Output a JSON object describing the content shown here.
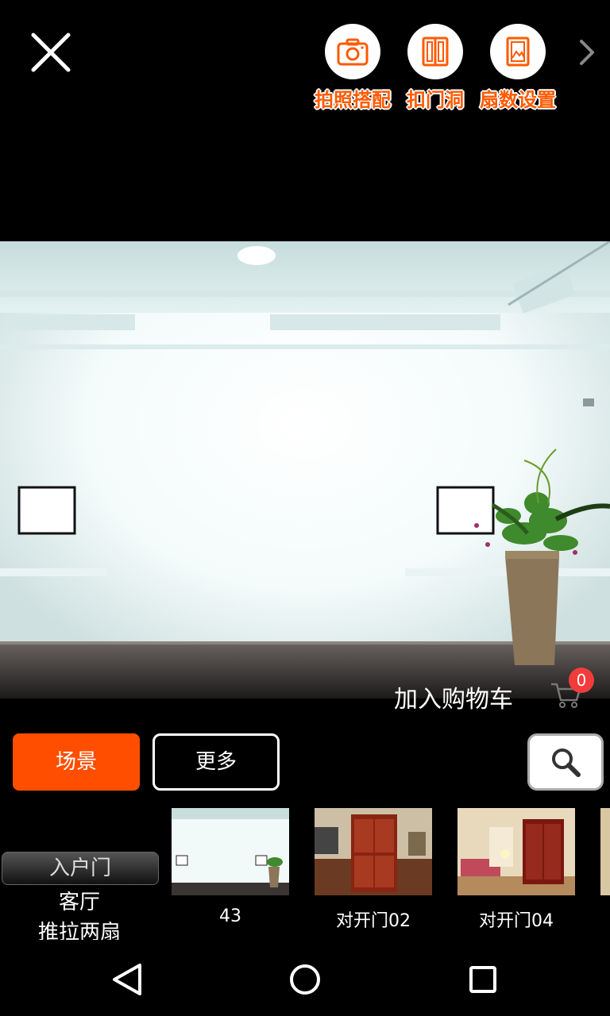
{
  "toolbar": {
    "close_icon": "close-icon",
    "tools": [
      {
        "label": "拍照搭配",
        "icon": "camera-icon"
      },
      {
        "label": "扣门洞",
        "icon": "door-frame-icon"
      },
      {
        "label": "扇数设置",
        "icon": "door-panel-icon"
      }
    ],
    "next_icon": "chevron-right-icon",
    "accent_color": "#ff5a00"
  },
  "cart": {
    "label": "加入购物车",
    "count": "0",
    "icon": "shopping-cart-icon"
  },
  "filters": {
    "scene_label": "场景",
    "more_label": "更多",
    "search_icon": "search-icon",
    "active_color": "#ff4e00"
  },
  "category": {
    "tab": "入户门",
    "room": "客厅",
    "type": "推拉两扇"
  },
  "thumbnails": [
    {
      "caption": "43"
    },
    {
      "caption": "对开门02"
    },
    {
      "caption": "对开门04"
    }
  ],
  "navbar": {
    "back_icon": "back-triangle-icon",
    "home_icon": "home-circle-icon",
    "recents_icon": "recents-square-icon"
  }
}
